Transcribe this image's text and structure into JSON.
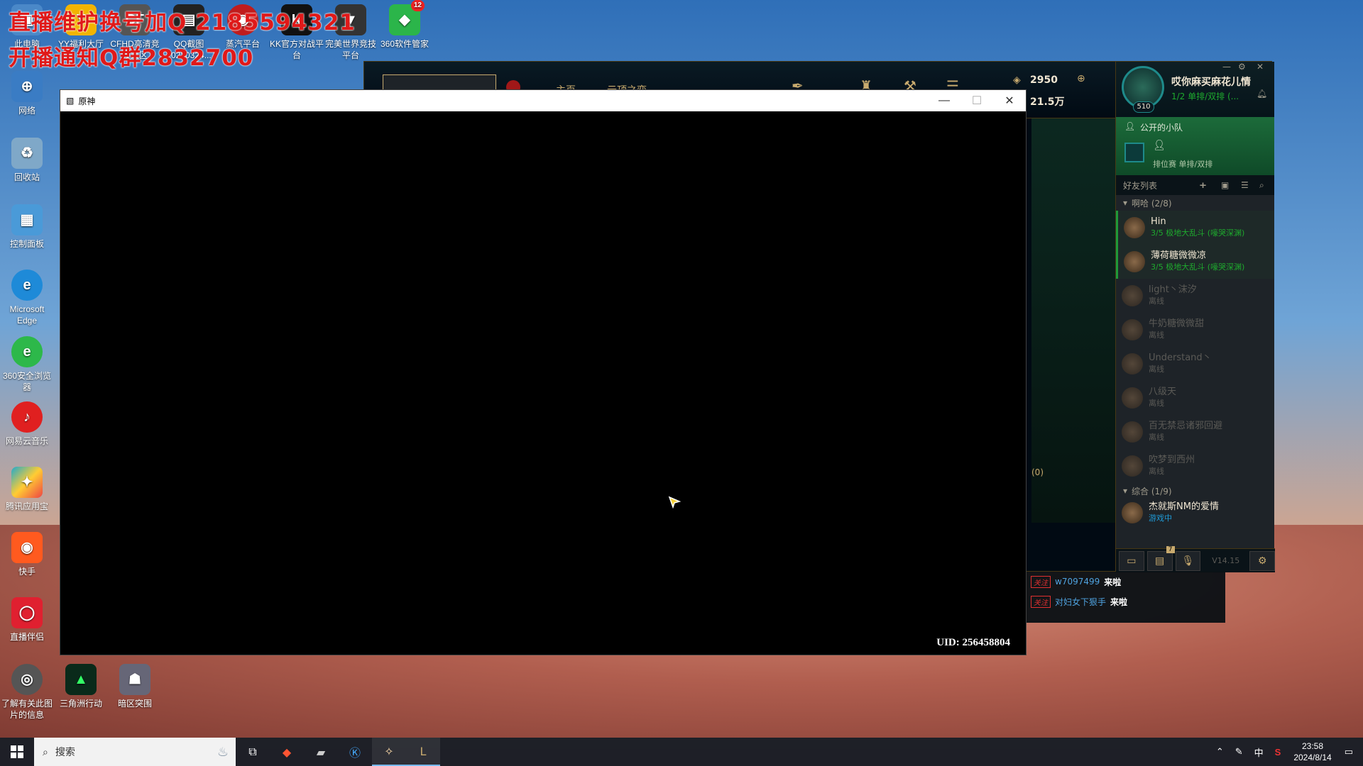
{
  "overlay": {
    "line1": "直播维护换号加Q 2185594321",
    "line2": "开播通知Q群2832700"
  },
  "desktop_icons": {
    "top_row": [
      {
        "label": "此电脑"
      },
      {
        "label": "YY福利大厅"
      },
      {
        "label": "CFHD高清竞技大区"
      },
      {
        "label": "QQ截图20230324..."
      },
      {
        "label": "蒸汽平台"
      },
      {
        "label": "KK官方对战平台"
      },
      {
        "label": "完美世界竞技平台"
      },
      {
        "label": "360软件管家",
        "badge": "12"
      }
    ],
    "left_column": [
      {
        "label": "网络"
      },
      {
        "label": "回收站"
      },
      {
        "label": "控制面板"
      },
      {
        "label": "Microsoft Edge"
      },
      {
        "label": "360安全浏览器"
      },
      {
        "label": "网易云音乐"
      },
      {
        "label": "腾讯应用宝"
      },
      {
        "label": "快手"
      },
      {
        "label": "直播伴侣"
      },
      {
        "label": "了解有关此图片的信息"
      }
    ],
    "bottom_row": [
      {
        "label": "三角洲行动"
      },
      {
        "label": "暗区突围"
      }
    ]
  },
  "lol_client": {
    "nav_home": "主页",
    "nav_tft": "云顶之弈",
    "currency_be": "2950",
    "currency_rp": "21.5万",
    "summoner": {
      "name": "哎你麻买麻花儿情",
      "level": "510",
      "status": "1/2 单排/双排 (..."
    },
    "party": {
      "title": "公开的小队",
      "mode": "排位赛 单排/双排"
    },
    "friends_header": "好友列表",
    "groups": [
      {
        "name": "啊哈 (2/8)",
        "friends": [
          {
            "name": "Hin",
            "status": "3/5 极地大乱斗 (嚎哭深渊)",
            "state": "online"
          },
          {
            "name": "薄荷糖微微凉",
            "status": "3/5 极地大乱斗 (嚎哭深渊)",
            "state": "online"
          },
          {
            "name": "light丶沫汐",
            "status": "离线",
            "state": "offline"
          },
          {
            "name": "牛奶糖微微甜",
            "status": "离线",
            "state": "offline"
          },
          {
            "name": "Understand丶",
            "status": "离线",
            "state": "offline"
          },
          {
            "name": "八级天",
            "status": "离线",
            "state": "offline"
          },
          {
            "name": "百无禁忌诸邪回避",
            "status": "离线",
            "state": "offline"
          },
          {
            "name": "吹梦到西州",
            "status": "离线",
            "state": "offline"
          }
        ]
      },
      {
        "name": "综合 (1/9)",
        "friends": [
          {
            "name": "杰就斯NM的爱情",
            "status": "游戏中",
            "state": "ingame"
          }
        ]
      }
    ],
    "partial_list_label": "(0)",
    "version": "V14.15",
    "notif_badge": "7"
  },
  "chat_notices": [
    {
      "tag": "关注",
      "user": "w7097499",
      "msg": "来啦"
    },
    {
      "tag": "关注",
      "user": "对妇女下狠手",
      "msg": "来啦"
    }
  ],
  "game_window": {
    "title": "原神",
    "uid": "UID: 256458804"
  },
  "taskbar": {
    "search_placeholder": "搜索",
    "ime": "中",
    "time": "23:58",
    "date": "2024/8/14"
  }
}
